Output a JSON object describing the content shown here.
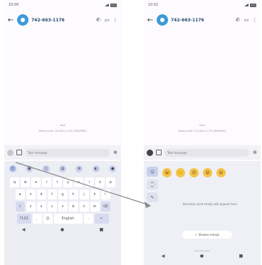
{
  "left": {
    "status_time": "10:00",
    "contact_name": "742-663-1176",
    "conversation_time": "Now",
    "conversation_note": "Texting with 742-663-1176 (SMS/MMS)",
    "compose_placeholder": "Text message",
    "keyboard": {
      "row1": [
        "q",
        "w",
        "e",
        "r",
        "t",
        "y",
        "u",
        "i",
        "o",
        "p"
      ],
      "row2": [
        "a",
        "s",
        "d",
        "f",
        "g",
        "h",
        "j",
        "k",
        "l"
      ],
      "row3": [
        "z",
        "x",
        "c",
        "v",
        "b",
        "n",
        "m"
      ],
      "shift_label": "⇧",
      "backspace_label": "⌫",
      "mode_label": "?123",
      "comma_label": ",",
      "space_label": "English",
      "period_label": ".",
      "enter_label": "↵"
    },
    "nav": [
      "◀",
      "●",
      "■"
    ]
  },
  "right": {
    "status_time": "10:01",
    "contact_name": "742-663-1176",
    "conversation_time": "Now",
    "conversation_note": "Texting with 742-663-1176 (SMS/MMS)",
    "compose_placeholder": "Text message",
    "emoji_faces": [
      "😀",
      "🙂",
      "😍",
      "😆",
      "😄"
    ],
    "emoji_tab_icons": [
      "☺",
      "⌚",
      "✎"
    ],
    "emoji_message": "Recently used emojis will appear here",
    "emoji_button_label": "Browse emojis",
    "emoji_caption": "Recently used",
    "nav": [
      "◀",
      "●",
      "■"
    ]
  },
  "colors": {
    "accent": "#3f9ad8",
    "arrow": "#8a8a8a"
  }
}
